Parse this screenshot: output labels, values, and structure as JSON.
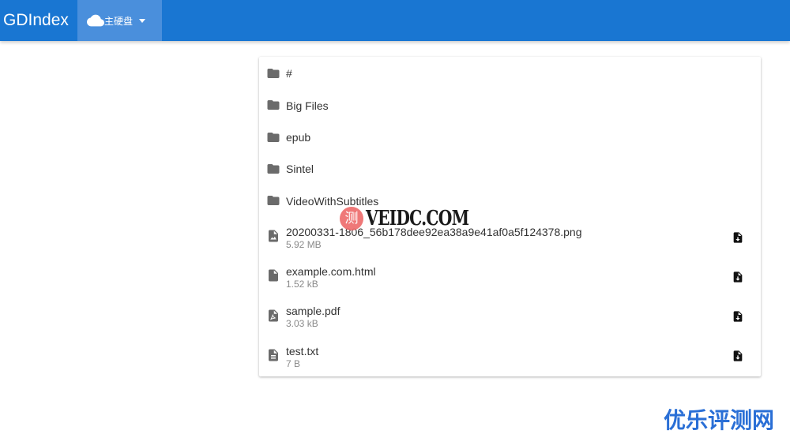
{
  "header": {
    "title": "GDIndex",
    "drive_selector": {
      "label": "主硬盘",
      "icon": "cloud-icon"
    },
    "background": "#1976d2",
    "selector_background": "#4a8fdc"
  },
  "file_list": {
    "folders": [
      {
        "name": "#",
        "icon": "folder-icon"
      },
      {
        "name": "Big Files",
        "icon": "folder-icon"
      },
      {
        "name": "epub",
        "icon": "folder-icon"
      },
      {
        "name": "Sintel",
        "icon": "folder-icon"
      },
      {
        "name": "VideoWithSubtitles",
        "icon": "folder-icon"
      }
    ],
    "files": [
      {
        "name": "20200331-1806_56b178dee92ea38a9e41af0a5f124378.png",
        "size": "5.92 MB",
        "icon": "image-file-icon",
        "action_icon": "download-icon"
      },
      {
        "name": "example.com.html",
        "size": "1.52 kB",
        "icon": "file-icon",
        "action_icon": "download-icon"
      },
      {
        "name": "sample.pdf",
        "size": "3.03 kB",
        "icon": "pdf-file-icon",
        "action_icon": "download-icon"
      },
      {
        "name": "test.txt",
        "size": "7 B",
        "icon": "text-file-icon",
        "action_icon": "download-icon"
      }
    ]
  },
  "watermarks": {
    "center_badge": "测",
    "center_text": "VEIDC.COM",
    "corner_text": "优乐评测网"
  }
}
